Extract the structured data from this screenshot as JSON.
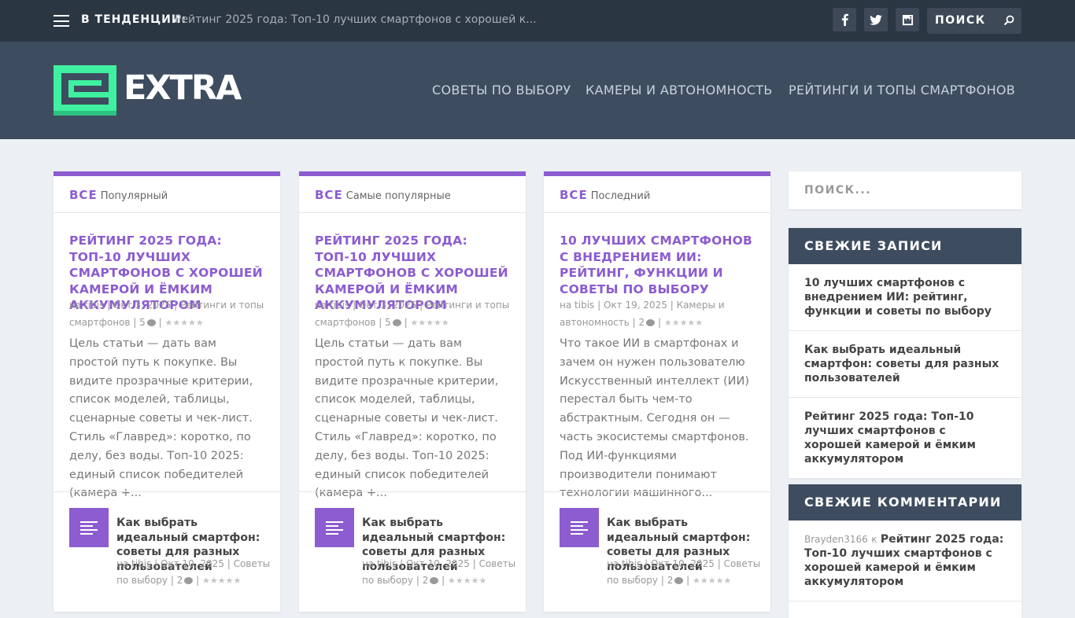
{
  "topbar": {
    "trending_label": "В ТЕНДЕНЦИИ:",
    "trending_text": "Рейтинг 2025 года: Топ-10 лучших смартфонов с хорошей к...",
    "search_label": "ПОИСК",
    "social": [
      "facebook-icon",
      "twitter-icon",
      "instagram-icon"
    ]
  },
  "header": {
    "logo_text": "EXTRA",
    "nav": [
      "СОВЕТЫ ПО ВЫБОРУ",
      "КАМЕРЫ И АВТОНОМНОСТЬ",
      "РЕЙТИНГИ И ТОПЫ СМАРТФОНОВ"
    ]
  },
  "colors": {
    "accent": "#8c5cd0",
    "header_bg": "#3e4c5f",
    "topbar_bg": "#2b3643",
    "logo_green": "#3ef0a0"
  },
  "cards": [
    {
      "all": "ВСЕ",
      "tab": "Популярный",
      "title": "Рейтинг 2025 года: Топ-10 лучших смартфонов с хорошей камерой и ёмким аккумулятором",
      "by": "на",
      "author": "tibis",
      "date": "Окт 3, 2025",
      "category": "Рейтинги и топы смартфонов",
      "comments": "5",
      "excerpt": "Цель статьи — дать вам простой путь к покупке. Вы видите прозрачные критерии, список моделей, таблицы, сценарные советы и чек-лист. Стиль «Главред»: коротко, по делу, без воды. Топ-10 2025: единый список победителей (камера +...",
      "mini": {
        "title": "Как выбрать идеальный смартфон: советы для разных пользователей",
        "by": "на",
        "author": "tibis",
        "date": "Окт 10, 2025",
        "category": "Советы по выбору",
        "comments": "2"
      }
    },
    {
      "all": "ВСЕ",
      "tab": "Самые популярные",
      "title": "Рейтинг 2025 года: Топ-10 лучших смартфонов с хорошей камерой и ёмким аккумулятором",
      "by": "на",
      "author": "tibis",
      "date": "Окт 3, 2025",
      "category": "Рейтинги и топы смартфонов",
      "comments": "5",
      "excerpt": "Цель статьи — дать вам простой путь к покупке. Вы видите прозрачные критерии, список моделей, таблицы, сценарные советы и чек-лист. Стиль «Главред»: коротко, по делу, без воды. Топ-10 2025: единый список победителей (камера +...",
      "mini": {
        "title": "Как выбрать идеальный смартфон: советы для разных пользователей",
        "by": "на",
        "author": "tibis",
        "date": "Окт 10, 2025",
        "category": "Советы по выбору",
        "comments": "2"
      }
    },
    {
      "all": "ВСЕ",
      "tab": "Последний",
      "title": "10 лучших смартфонов с внедрением ИИ: рейтинг, функции и советы по выбору",
      "by": "на",
      "author": "tibis",
      "date": "Окт 19, 2025",
      "category": "Камеры и автономность",
      "comments": "2",
      "excerpt": "Что такое ИИ в смартфонах и зачем он нужен пользователю Искусственный интеллект (ИИ) перестал быть чем-то абстрактным. Сегодня он — часть экосистемы смартфонов. Под ИИ-функциями производители понимают технологии машинного...",
      "mini": {
        "title": "Как выбрать идеальный смартфон: советы для разных пользователей",
        "by": "на",
        "author": "tibis",
        "date": "Окт 10, 2025",
        "category": "Советы по выбору",
        "comments": "2"
      }
    }
  ],
  "sidebar": {
    "search_placeholder": "ПОИСК...",
    "recent_posts": {
      "title": "СВЕЖИЕ ЗАПИСИ",
      "items": [
        "10 лучших смартфонов с внедрением ИИ: рейтинг, функции и советы по выбору",
        "Как выбрать идеальный смартфон: советы для разных пользователей",
        "Рейтинг 2025 года: Топ-10 лучших смартфонов с хорошей камерой и ёмким аккумулятором"
      ]
    },
    "recent_comments": {
      "title": "СВЕЖИЕ КОММЕНТАРИИ",
      "items": [
        {
          "author": "Brayden3166",
          "on": "к",
          "post": "Рейтинг 2025 года: Топ-10 лучших смартфонов с хорошей камерой и ёмким аккумулятором"
        }
      ]
    }
  }
}
